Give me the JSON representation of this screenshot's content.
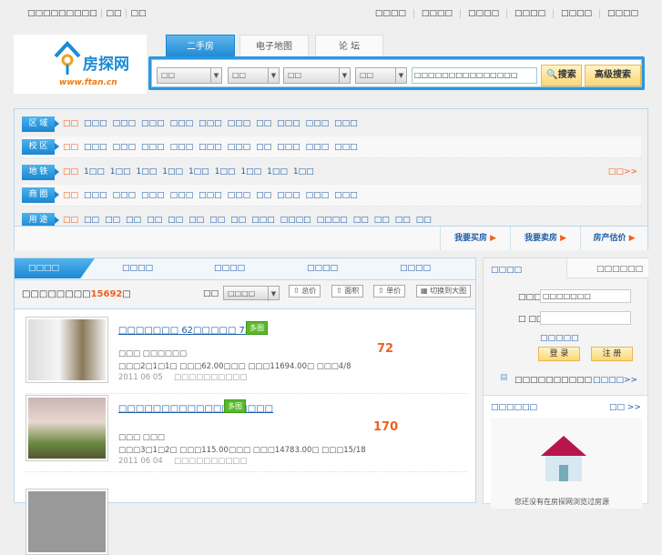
{
  "top": {
    "left": [
      "□□□□□□□□□",
      "□□",
      "□□"
    ],
    "right": [
      "□□□□",
      "□□□□",
      "□□□□",
      "□□□□",
      "□□□□",
      "□□□□"
    ]
  },
  "logo": {
    "name": "房探网",
    "url": "www.ftan.cn"
  },
  "tabs": [
    "二手房",
    "电子地图",
    "论 坛"
  ],
  "search": {
    "selects": [
      "□□",
      "□□",
      "□□",
      "□□"
    ],
    "input": "□□□□□□□□□□□□□□□",
    "search": "搜索",
    "advanced": "高级搜索"
  },
  "filters": [
    {
      "label": "区 域",
      "items": [
        "□□",
        "□□□",
        "□□□",
        "□□□",
        "□□□",
        "□□□",
        "□□□",
        "□□",
        "□□□",
        "□□□",
        "□□□"
      ]
    },
    {
      "label": "校 区",
      "items": [
        "□□",
        "□□□",
        "□□□",
        "□□□",
        "□□□",
        "□□□",
        "□□□",
        "□□",
        "□□□",
        "□□□",
        "□□□"
      ]
    },
    {
      "label": "地 铁",
      "items": [
        "□□",
        "1□□",
        "1□□",
        "1□□",
        "1□□",
        "1□□",
        "1□□",
        "1□□",
        "1□□",
        "1□□"
      ],
      "more": "□□>>"
    },
    {
      "label": "商 圈",
      "items": [
        "□□",
        "□□□",
        "□□□",
        "□□□",
        "□□□",
        "□□□",
        "□□□",
        "□□",
        "□□□",
        "□□□",
        "□□□"
      ]
    },
    {
      "label": "用 途",
      "items": [
        "□□",
        "□□",
        "□□",
        "□□",
        "□□",
        "□□",
        "□□",
        "□□",
        "□□",
        "□□□",
        "□□□□",
        "□□□□",
        "□□",
        "□□",
        "□□",
        "□□"
      ]
    }
  ],
  "actions": [
    "我要买房",
    "我要卖房",
    "房产估价"
  ],
  "list": {
    "tabs": [
      "□□□□",
      "□□□□",
      "□□□□",
      "□□□□",
      "□□□□"
    ],
    "count_prefix": "□□□□□□□□",
    "count": "15692",
    "count_suffix": "□",
    "sort_label": "□□",
    "sort_value": "□□□□",
    "sort_buttons": [
      "总价",
      "面积",
      "单价",
      "切换到大图"
    ],
    "items": [
      {
        "title": "□□□□□□□ 62□□□□□ 72.5□",
        "badge": "多图",
        "price": "72",
        "line1": "□□□ □□□□□□",
        "line2": "□□□2□1□1□ □□□62.00□□□ □□□11694.00□ □□□4/8",
        "date": "2011 06 05",
        "agent": "□□□□□□□□□□"
      },
      {
        "title": "□□□□□□□□□□□□□□□□□□",
        "badge": "多图",
        "price": "170",
        "line1": "□□□ □□□",
        "line2": "□□□3□1□2□ □□□115.00□□□ □□□14783.00□ □□□15/18",
        "date": "2011 06 04",
        "agent": "□□□□□□□□□□"
      }
    ]
  },
  "login": {
    "tab1": "□□□□",
    "tab2": "□□□□□□",
    "user_label": "□□□□",
    "user_value": "□□□□□□□",
    "pass_label": "□ □□",
    "forgot": "□□□□□",
    "login": "登 录",
    "register": "注 册",
    "note": "□□□□□□□□□□",
    "more": "□□□□>>"
  },
  "recent": {
    "title": "□□□□□□",
    "more": "□□ >>",
    "empty": "您还没有在房探网浏览过房源"
  }
}
